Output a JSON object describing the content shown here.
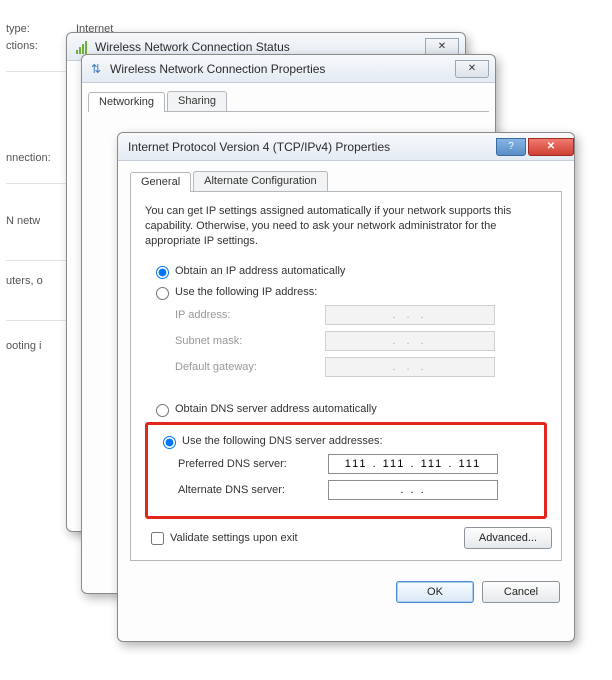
{
  "bg": {
    "type_label": "type:",
    "type_value": "Internet",
    "ctions_label": "ctions:",
    "nnection_label": "nnection:",
    "n_netw_label": "N netw",
    "uters_label": "uters, o",
    "ooting_label": "ooting i"
  },
  "win1": {
    "title": "Wireless Network Connection Status"
  },
  "win2": {
    "title": "Wireless Network Connection Properties",
    "tab_networking": "Networking",
    "tab_sharing": "Sharing"
  },
  "win3": {
    "title": "Internet Protocol Version 4 (TCP/IPv4) Properties",
    "tab_general": "General",
    "tab_alt": "Alternate Configuration",
    "description": "You can get IP settings assigned automatically if your network supports this capability. Otherwise, you need to ask your network administrator for the appropriate IP settings.",
    "ip": {
      "radio_auto": "Obtain an IP address automatically",
      "radio_manual": "Use the following IP address:",
      "field_ip": "IP address:",
      "field_mask": "Subnet mask:",
      "field_gw": "Default gateway:",
      "placeholder": ".       .       ."
    },
    "dns": {
      "radio_auto": "Obtain DNS server address automatically",
      "radio_manual": "Use the following DNS server addresses:",
      "field_pref": "Preferred DNS server:",
      "field_alt": "Alternate DNS server:",
      "value_pref": "111 . 111 . 111 . 111",
      "value_alt": ".        .        ."
    },
    "validate": "Validate settings upon exit",
    "btn_advanced": "Advanced...",
    "btn_ok": "OK",
    "btn_cancel": "Cancel"
  }
}
